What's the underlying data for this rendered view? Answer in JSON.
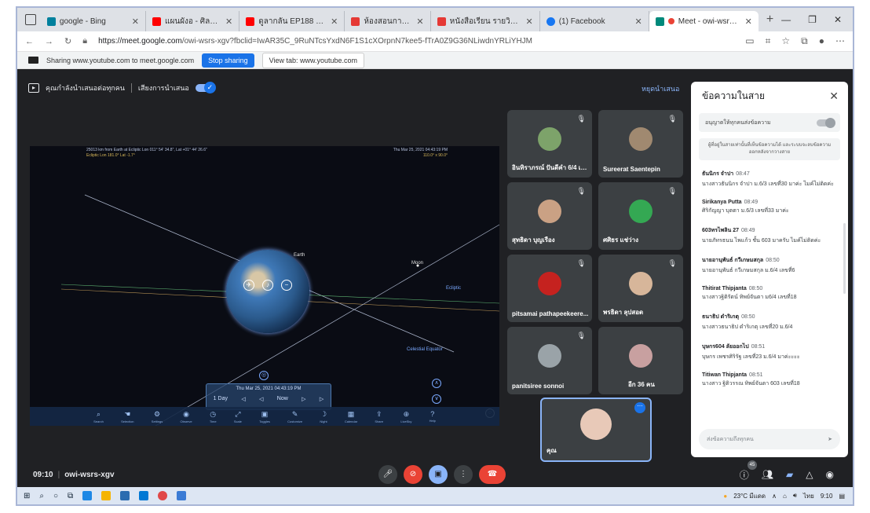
{
  "browser": {
    "tabs": [
      {
        "title": "google - Bing",
        "fav_color": "#00809d"
      },
      {
        "title": "แผนผังอ - ศิลปิน - YouTube",
        "fav_color": "#ff0000"
      },
      {
        "title": "ดูลากลัน EP188 ฤดูกาล Seas",
        "fav_color": "#ff0000"
      },
      {
        "title": "ห้องสอนการสอน มัธยมปลาย อนุ",
        "fav_color": "#e53935"
      },
      {
        "title": "หนังสือเรียน รายวิชาพื้นฐาน ภูมิศาสต",
        "fav_color": "#e53935"
      },
      {
        "title": "(1) Facebook",
        "fav_color": "#1877f2"
      },
      {
        "title": "Meet - owi-wsrs-xgv",
        "fav_color": "#00897b"
      }
    ],
    "url_host": "https://meet.google.com",
    "url_path": "/owi-wsrs-xgv?fbclid=IwAR35C_9RuNTcsYxdN6F1S1cXOrpnN7kee5-fTrA0Z9G36NLiwdnYRLiYHJM"
  },
  "sharing": {
    "text": "Sharing www.youtube.com to meet.google.com",
    "stop_label": "Stop sharing",
    "view_label": "View tab: www.youtube.com"
  },
  "banner": {
    "presenting": "คุณกำลังนำเสนอต่อทุกคน",
    "audio": "เสียงการนำเสนอ",
    "stop": "หยุดนำเสนอ"
  },
  "screen": {
    "hdr1": "25013 km from Earth at Ecliptic Lon 011° 54' 34.8\", Lat +01° 44' 26.6\"",
    "hdr2": "Ecliptic Lon 181.0° Lat -1.7°",
    "hdr_r1": "Thu Mar 25, 2021  04:43:19 PM",
    "hdr_r2": "110.0° x 90.0°",
    "earth": "Earth",
    "moon": "Moon",
    "ecliptic": "Ecliptic",
    "equator": "Celestial Equator",
    "time": "Thu Mar 25, 2021  04:43:19 PM",
    "step": "1 Day",
    "now": "Now",
    "tools": [
      "Search",
      "Selection",
      "Settings",
      "Observe",
      "Time",
      "Scale",
      "Toggles",
      "Customize",
      "Night",
      "Calendar",
      "Share",
      "LiveSky",
      "Help"
    ]
  },
  "participants": [
    {
      "name": "อินทิราภรณ์ ปันดีคำ 6/4 เล...",
      "color": "#7da36a"
    },
    {
      "name": "Sureerat Saentepin",
      "color": "#a08970"
    },
    {
      "name": "สุทธิดา บุญเรือง",
      "color": "#caa184"
    },
    {
      "name": "ศศิธร แช่ว่าง",
      "color": "#34a853"
    },
    {
      "name": "pitsamai pathapeekeere...",
      "color": "#c5221f"
    },
    {
      "name": "พรธิดา ลุปสอด",
      "color": "#d7b69a"
    },
    {
      "name": "panitsiree sonnoi",
      "color": "#9aa3a8"
    },
    {
      "name": "อีก 36 คน",
      "color": "#c8a0a0"
    }
  ],
  "self_tile": {
    "name": "คุณ"
  },
  "chat": {
    "title": "ข้อความในสาย",
    "allow": "อนุญาตให้ทุกคนส่งข้อความ",
    "note": "ผู้ที่อยู่ในสายเท่านั้นที่เห็นข้อความได้ และระบบจะลบข้อความออกหลังจากวางสาย",
    "messages": [
      {
        "who": "ธันนิกร จำปา",
        "time": "08:47",
        "text": "นางสาวธันนิกร จำปา ม.6/3 เลขที่30 มาค่ะ ไมค์ไม่ติดค่ะ"
      },
      {
        "who": "Sirikanya Putta",
        "time": "08:49",
        "text": "ศิริกัญญา บุตตา ม.6/3 เลขที่33 มาค่ะ"
      },
      {
        "who": "603ทรไพลิน 27",
        "time": "08:49",
        "text": "นายภัทรธนน ไพแก้ว ชั้น 603 มาครับ ไมค์ไม่ติดค่ะ"
      },
      {
        "who": "นายอานุพันธ์ กวีเกษมสกุล",
        "time": "08:50",
        "text": "นายอานุพันธ์ กวีเกษมสกุล ม.6/4 เลขที่6"
      },
      {
        "who": "Thitirat Thipjanta",
        "time": "08:50",
        "text": "นางสาวฐิติรัตน์ ทิพย์จันตา ม6/4 เลขที่18"
      },
      {
        "who": "ธนาธิป ดำริเกตุ",
        "time": "08:50",
        "text": "นางสาวธนาธิป ดำริเกตุ เลขที่20 ม.6/4"
      },
      {
        "who": "บุษกร604 ลัยออกไป",
        "time": "08:51",
        "text": "บุษกร เพชรศิริรัฐ เลขที่23 ม.6/4 มาค่ะะะะ"
      },
      {
        "who": "Titiwan Thipjanta",
        "time": "08:51",
        "text": "นางสาว ฐิติวรรณ ทิพย์จันตา 603 เลขที่18"
      }
    ],
    "input_placeholder": "ส่งข้อความถึงทุกคน"
  },
  "meetbar": {
    "time": "09:10",
    "code": "owi-wsrs-xgv",
    "people_count": "45"
  },
  "taskbar": {
    "weather": "23°C มีแดด",
    "lang": "ไทย",
    "clock": "9:10"
  }
}
